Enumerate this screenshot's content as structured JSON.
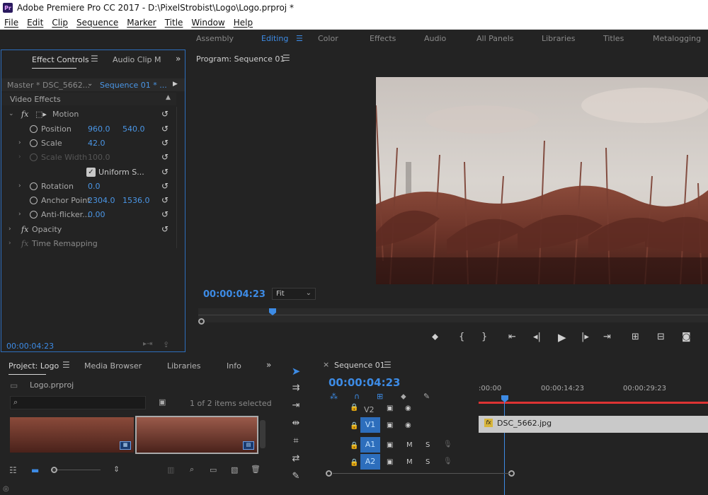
{
  "window": {
    "title": "Adobe Premiere Pro CC 2017 - D:\\PixelStrobist\\Logo\\Logo.prproj *",
    "app_icon": "Pr"
  },
  "menu": [
    "File",
    "Edit",
    "Clip",
    "Sequence",
    "Marker",
    "Title",
    "Window",
    "Help"
  ],
  "workspaces": [
    "Assembly",
    "Editing",
    "Color",
    "Effects",
    "Audio",
    "All Panels",
    "Libraries",
    "Titles",
    "Metalogging"
  ],
  "effect_controls": {
    "tabs": [
      "Effect Controls",
      "Audio Clip M"
    ],
    "master": "Master * DSC_5662...",
    "sequence": "Sequence 01 * ...",
    "section": "Video Effects",
    "motion": "Motion",
    "position_label": "Position",
    "position_x": "960.0",
    "position_y": "540.0",
    "scale_label": "Scale",
    "scale_val": "42.0",
    "scale_width_label": "Scale Width",
    "scale_width_val": "100.0",
    "uniform_label": "Uniform S...",
    "rotation_label": "Rotation",
    "rotation_val": "0.0",
    "anchor_label": "Anchor Point",
    "anchor_x": "2304.0",
    "anchor_y": "1536.0",
    "antiflicker_label": "Anti-flicker...",
    "antiflicker_val": "0.00",
    "opacity": "Opacity",
    "time_remap": "Time Remapping",
    "timecode": "00:00:04:23"
  },
  "program": {
    "title": "Program: Sequence 01",
    "timecode": "00:00:04:23",
    "fit": "Fit"
  },
  "project": {
    "tabs": [
      "Project: Logo",
      "Media Browser",
      "Libraries",
      "Info"
    ],
    "file": "Logo.prproj",
    "search_placeholder": "",
    "selected_count": "1 of 2 items selected"
  },
  "sequence": {
    "tab": "Sequence 01",
    "timecode": "00:00:04:23",
    "ruler": [
      ":00:00",
      "00:00:14:23",
      "00:00:29:23"
    ],
    "tracks": [
      "V2",
      "V1",
      "A1",
      "A2"
    ],
    "clip": "DSC_5662.jpg",
    "clip_fx": "fx",
    "m": "M",
    "s": "S"
  }
}
